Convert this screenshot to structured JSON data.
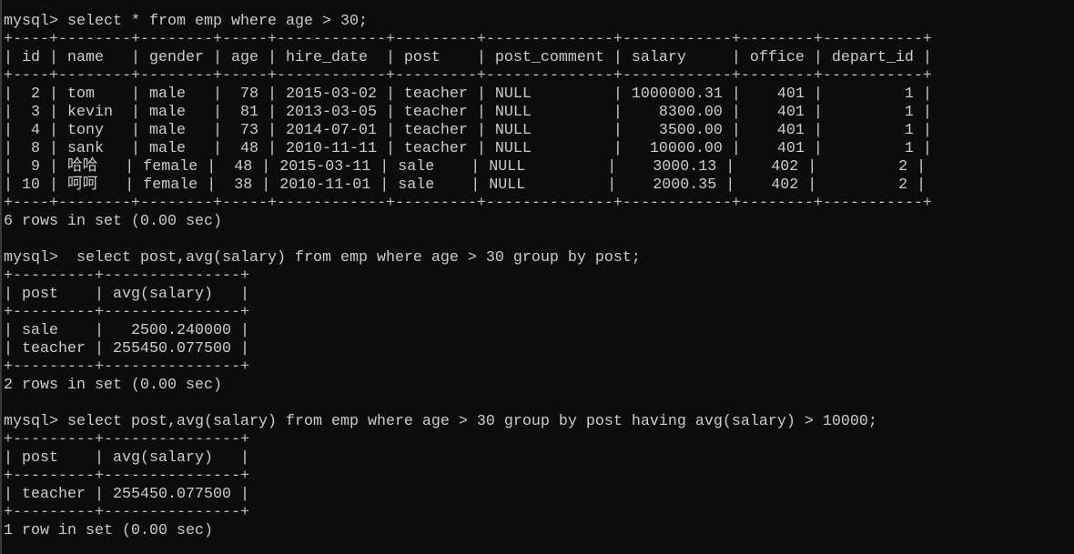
{
  "terminal": {
    "prompt": "mysql>",
    "blocks": [
      {
        "command": "select * from emp where age > 30;",
        "command_prefix": " ",
        "columns": [
          "id",
          "name",
          "gender",
          "age",
          "hire_date",
          "post",
          "post_comment",
          "salary",
          "office",
          "depart_id"
        ],
        "rows": [
          [
            "2",
            "tom",
            "male",
            "78",
            "2015-03-02",
            "teacher",
            "NULL",
            "1000000.31",
            "401",
            "1"
          ],
          [
            "3",
            "kevin",
            "male",
            "81",
            "2013-03-05",
            "teacher",
            "NULL",
            "8300.00",
            "401",
            "1"
          ],
          [
            "4",
            "tony",
            "male",
            "73",
            "2014-07-01",
            "teacher",
            "NULL",
            "3500.00",
            "401",
            "1"
          ],
          [
            "8",
            "sank",
            "male",
            "48",
            "2010-11-11",
            "teacher",
            "NULL",
            "10000.00",
            "401",
            "1"
          ],
          [
            "9",
            "哈哈",
            "female",
            "48",
            "2015-03-11",
            "sale",
            "NULL",
            "3000.13",
            "402",
            "2"
          ],
          [
            "10",
            "呵呵",
            "female",
            "38",
            "2010-11-01",
            "sale",
            "NULL",
            "2000.35",
            "402",
            "2"
          ]
        ],
        "status": "6 rows in set (0.00 sec)"
      },
      {
        "command": "select post,avg(salary) from emp where age > 30 group by post;",
        "command_prefix": "  ",
        "columns": [
          "post",
          "avg(salary)"
        ],
        "rows": [
          [
            "sale",
            "2500.240000"
          ],
          [
            "teacher",
            "255450.077500"
          ]
        ],
        "status": "2 rows in set (0.00 sec)"
      },
      {
        "command": "select post,avg(salary) from emp where age > 30 group by post having avg(salary) > 10000;",
        "command_prefix": " ",
        "columns": [
          "post",
          "avg(salary)"
        ],
        "rows": [
          [
            "teacher",
            "255450.077500"
          ]
        ],
        "status": "1 row in set (0.00 sec)"
      }
    ],
    "lines": {
      "q1_cmd": "mysql> select * from emp where age > 30;",
      "q1_top": "+----+--------+--------+-----+------------+---------+--------------+------------+--------+-----------+",
      "q1_head": "| id | name   | gender | age | hire_date  | post    | post_comment | salary     | office | depart_id |",
      "q1_sep": "+----+--------+--------+-----+------------+---------+--------------+------------+--------+-----------+",
      "q1_r0": "|  2 | tom    | male   |  78 | 2015-03-02 | teacher | NULL         | 1000000.31 |    401 |         1 |",
      "q1_r1": "|  3 | kevin  | male   |  81 | 2013-03-05 | teacher | NULL         |    8300.00 |    401 |         1 |",
      "q1_r2": "|  4 | tony   | male   |  73 | 2014-07-01 | teacher | NULL         |    3500.00 |    401 |         1 |",
      "q1_r3": "|  8 | sank   | male   |  48 | 2010-11-11 | teacher | NULL         |   10000.00 |    401 |         1 |",
      "q1_r4": "|  9 | 哈哈   | female |  48 | 2015-03-11 | sale    | NULL         |    3000.13 |    402 |         2 |",
      "q1_r5": "| 10 | 呵呵   | female |  38 | 2010-11-01 | sale    | NULL         |    2000.35 |    402 |         2 |",
      "q1_bot": "+----+--------+--------+-----+------------+---------+--------------+------------+--------+-----------+",
      "q1_status": "6 rows in set (0.00 sec)",
      "q2_cmd": "mysql>  select post,avg(salary) from emp where age > 30 group by post;",
      "q2_top": "+---------+---------------+",
      "q2_head": "| post    | avg(salary)   |",
      "q2_sep": "+---------+---------------+",
      "q2_r0": "| sale    |   2500.240000 |",
      "q2_r1": "| teacher | 255450.077500 |",
      "q2_bot": "+---------+---------------+",
      "q2_status": "2 rows in set (0.00 sec)",
      "q3_cmd": "mysql> select post,avg(salary) from emp where age > 30 group by post having avg(salary) > 10000;",
      "q3_top": "+---------+---------------+",
      "q3_head": "| post    | avg(salary)   |",
      "q3_sep": "+---------+---------------+",
      "q3_r0": "| teacher | 255450.077500 |",
      "q3_bot": "+---------+---------------+",
      "q3_status": "1 row in set (0.00 sec)"
    }
  },
  "colors": {
    "background": "#0c0c0c",
    "text": "#cccccc"
  }
}
